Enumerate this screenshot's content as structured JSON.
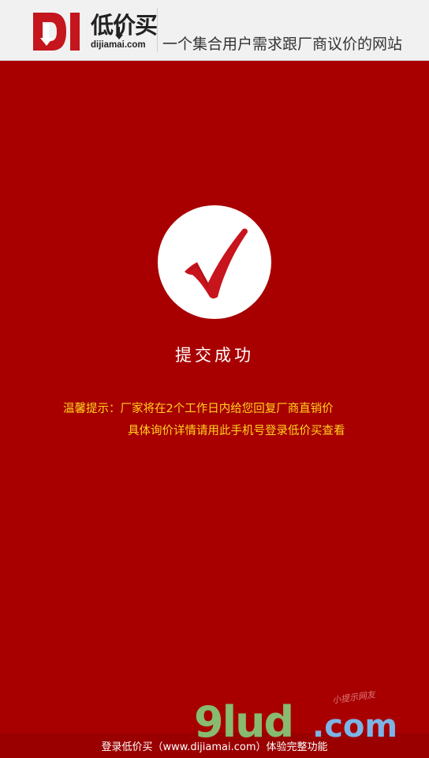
{
  "header": {
    "logo_cn": "低价买",
    "logo_url": "dijiamai.com",
    "tagline": "一个集合用户需求跟厂商议价的网站"
  },
  "status": {
    "title": "提交成功",
    "tip_line1": "温馨提示：厂家将在2个工作日内给您回复厂商直销价",
    "tip_line2": "具体询价详情请用此手机号登录低价买查看"
  },
  "footer": {
    "text": "登录低价买（www.dijiamai.com）体验完整功能"
  },
  "watermark": {
    "main": "9lud",
    "suffix": ".com",
    "tagline": "小提示网友"
  },
  "colors": {
    "background": "#a80000",
    "header_bg": "#f1f1f1",
    "brand_red": "#c4161c",
    "tip_yellow": "#ffd21f"
  },
  "icons": {
    "logo": "dijiamai-logo-icon",
    "success": "checkmark-icon"
  }
}
